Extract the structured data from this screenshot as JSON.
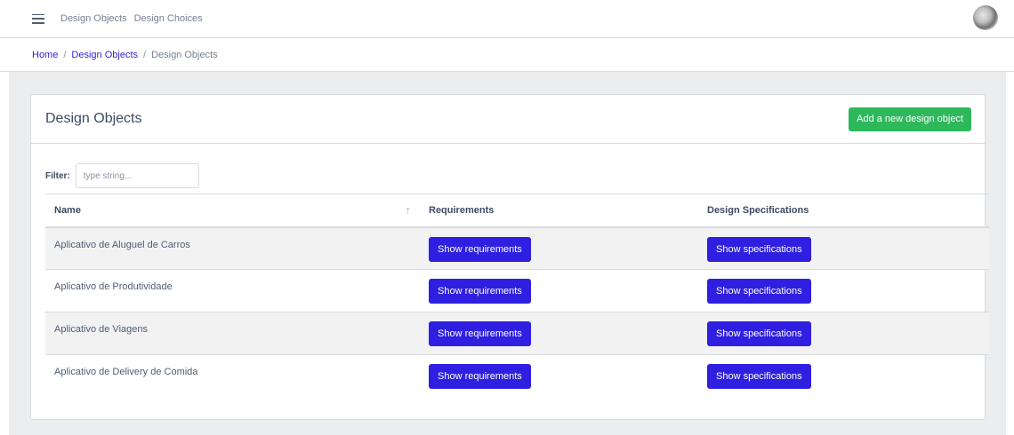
{
  "nav": {
    "links": [
      "Design Objects",
      "Design Choices"
    ]
  },
  "breadcrumb": {
    "home": "Home",
    "parent": "Design Objects",
    "current": "Design Objects",
    "separator": "/"
  },
  "card": {
    "title": "Design Objects",
    "add_button": "Add a new design object"
  },
  "filter": {
    "label": "Filter:",
    "placeholder": "type string...",
    "value": ""
  },
  "table": {
    "columns": [
      "Name",
      "Requirements",
      "Design Specifications"
    ],
    "sort_icon": "arrow-up-icon",
    "requirements_button": "Show requirements",
    "specifications_button": "Show specifications",
    "rows": [
      {
        "name": "Aplicativo de Aluguel de Carros"
      },
      {
        "name": "Aplicativo de Produtividade"
      },
      {
        "name": "Aplicativo de Viagens"
      },
      {
        "name": "Aplicativo de Delivery de Comida"
      }
    ]
  },
  "colors": {
    "primary": "#2f1fe0",
    "success": "#2eb85c",
    "background": "#ebedef"
  }
}
